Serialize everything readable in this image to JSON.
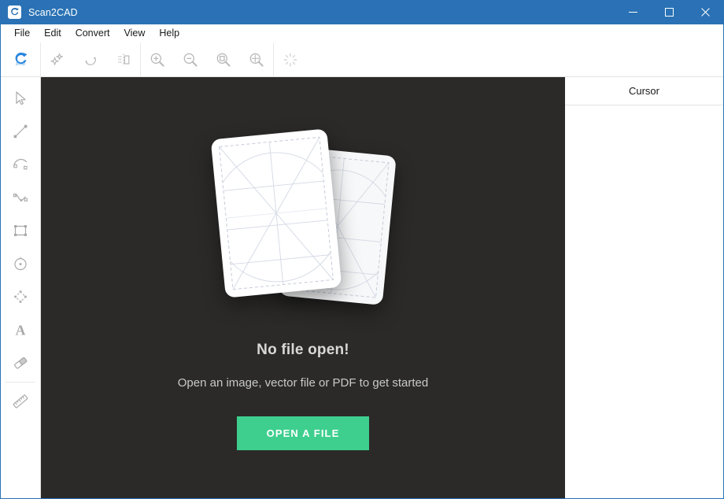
{
  "window": {
    "title": "Scan2CAD",
    "app_icon": "scan2cad-logo-icon",
    "controls": {
      "minimize": "minimize-icon",
      "maximize": "maximize-icon",
      "close": "close-icon"
    },
    "accent_color": "#2a72b5"
  },
  "menubar": {
    "items": [
      {
        "label": "File"
      },
      {
        "label": "Edit"
      },
      {
        "label": "Convert"
      },
      {
        "label": "View"
      },
      {
        "label": "Help"
      }
    ]
  },
  "toolbar": {
    "logo": "scan2cad-logo-icon",
    "buttons": [
      {
        "name": "clean-image-button",
        "icon": "sparkles-icon",
        "disabled": false
      },
      {
        "name": "rotate-button",
        "icon": "rotate-icon",
        "disabled": false
      },
      {
        "name": "mirror-button",
        "icon": "mirror-icon",
        "disabled": false
      },
      {
        "name": "zoom-in-button",
        "icon": "magnifier-plus-icon",
        "disabled": false
      },
      {
        "name": "zoom-out-button",
        "icon": "magnifier-minus-icon",
        "disabled": false
      },
      {
        "name": "zoom-to-selection-button",
        "icon": "magnifier-square-icon",
        "disabled": false
      },
      {
        "name": "zoom-to-fit-button",
        "icon": "magnifier-fit-icon",
        "disabled": false
      },
      {
        "name": "loading-button",
        "icon": "spinner-icon",
        "disabled": true
      }
    ]
  },
  "toolrail": {
    "tools": [
      {
        "name": "select-tool",
        "icon": "cursor-arrow-icon"
      },
      {
        "name": "line-tool",
        "icon": "line-icon"
      },
      {
        "name": "arc-tool",
        "icon": "arc-icon"
      },
      {
        "name": "curve-tool",
        "icon": "bezier-curve-icon"
      },
      {
        "name": "rectangle-tool",
        "icon": "rectangle-icon"
      },
      {
        "name": "circle-tool",
        "icon": "circle-icon"
      },
      {
        "name": "polygon-tool",
        "icon": "polygon-nodes-icon"
      },
      {
        "name": "text-tool",
        "icon": "text-a-icon"
      },
      {
        "name": "eraser-tool",
        "icon": "eraser-icon"
      },
      {
        "name": "measure-tool",
        "icon": "ruler-icon"
      }
    ]
  },
  "canvas": {
    "background_color": "#2b2a29",
    "empty_state": {
      "illustration": "stacked-drawing-sheets-illustration",
      "title": "No file open!",
      "subtitle": "Open an image, vector file or PDF to get started",
      "button_label": "OPEN A FILE",
      "button_color": "#3ecf8e"
    }
  },
  "right_panel": {
    "header": "Cursor",
    "content": ""
  }
}
